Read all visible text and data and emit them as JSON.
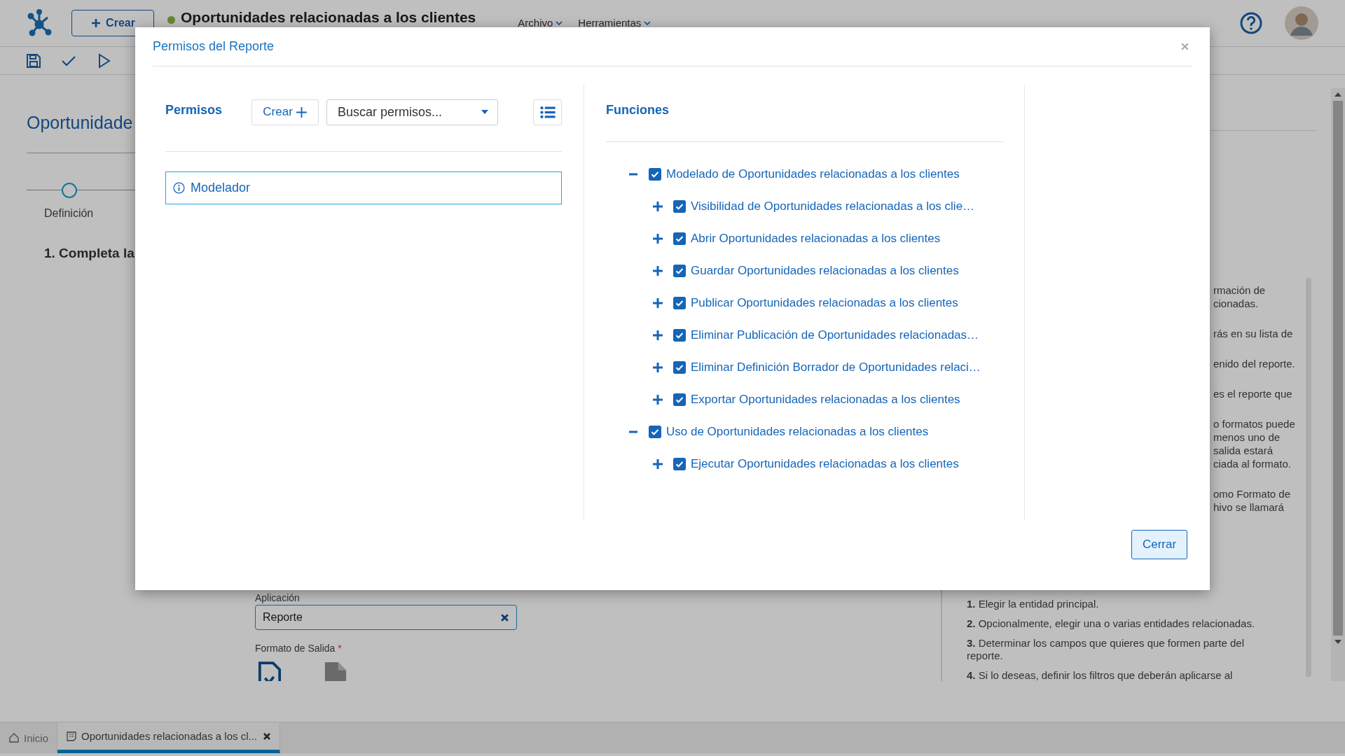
{
  "topbar": {
    "create_label": "Crear",
    "title": "Oportunidades relacionadas a los clientes",
    "menus": [
      {
        "label": "Archivo"
      },
      {
        "label": "Herramientas"
      }
    ]
  },
  "page": {
    "title": "Oportunidade",
    "step": "Definición",
    "section_heading": "1. Completa la",
    "application_label": "Aplicación",
    "application_value": "Reporte",
    "output_format_label": "Formato de Salida",
    "required_mark": "*"
  },
  "help_panel": {
    "paragraphs": [
      {
        "lines": [
          "rmación de",
          "cionadas."
        ]
      },
      {
        "lines": [
          "rás en su lista de"
        ]
      },
      {
        "lines": [
          "enido del reporte."
        ]
      },
      {
        "lines": [
          "es el reporte que"
        ]
      },
      {
        "lines": [
          "o formatos puede",
          "menos uno de",
          "salida estará",
          "ciada al formato."
        ]
      },
      {
        "lines": [
          "omo Formato de",
          "hivo se llamará"
        ]
      }
    ],
    "steps": [
      "**1.** Elegir la entidad principal.",
      "**2.** Opcionalmente, elegir una o varias entidades relacionadas.",
      "**3.** Determinar los campos que quieres que formen parte del reporte.",
      "**4.** Si lo deseas, definir los filtros que deberán aplicarse al"
    ]
  },
  "bottom_tabs": [
    {
      "label": "Inicio",
      "selected": false,
      "kind": "home"
    },
    {
      "label": "Oportunidades relacionadas a los cl...",
      "selected": true,
      "kind": "document"
    }
  ],
  "dialog": {
    "title": "Permisos del Reporte",
    "close_label": "Cerrar",
    "permissions": {
      "heading": "Permisos",
      "create_label": "Crear",
      "search_placeholder": "Buscar permisos...",
      "items": [
        {
          "label": "Modelador",
          "selected": true
        }
      ]
    },
    "functions": {
      "heading": "Funciones",
      "tree": [
        {
          "label": "Modelado de Oportunidades relacionadas a los clientes",
          "checked": true,
          "expanded": true,
          "children": [
            {
              "label": "Visibilidad de Oportunidades relacionadas a los clie…",
              "checked": true,
              "expanded": false
            },
            {
              "label": "Abrir Oportunidades relacionadas a los clientes",
              "checked": true,
              "expanded": false
            },
            {
              "label": "Guardar Oportunidades relacionadas a los clientes",
              "checked": true,
              "expanded": false
            },
            {
              "label": "Publicar Oportunidades relacionadas a los clientes",
              "checked": true,
              "expanded": false
            },
            {
              "label": "Eliminar Publicación de Oportunidades relacionadas…",
              "checked": true,
              "expanded": false
            },
            {
              "label": "Eliminar Definición Borrador de Oportunidades relaci…",
              "checked": true,
              "expanded": false
            },
            {
              "label": "Exportar Oportunidades relacionadas a los clientes",
              "checked": true,
              "expanded": false
            }
          ]
        },
        {
          "label": "Uso de Oportunidades relacionadas a los clientes",
          "checked": true,
          "expanded": true,
          "children": [
            {
              "label": "Ejecutar Oportunidades relacionadas a los clientes",
              "checked": true,
              "expanded": false
            }
          ]
        }
      ]
    }
  }
}
